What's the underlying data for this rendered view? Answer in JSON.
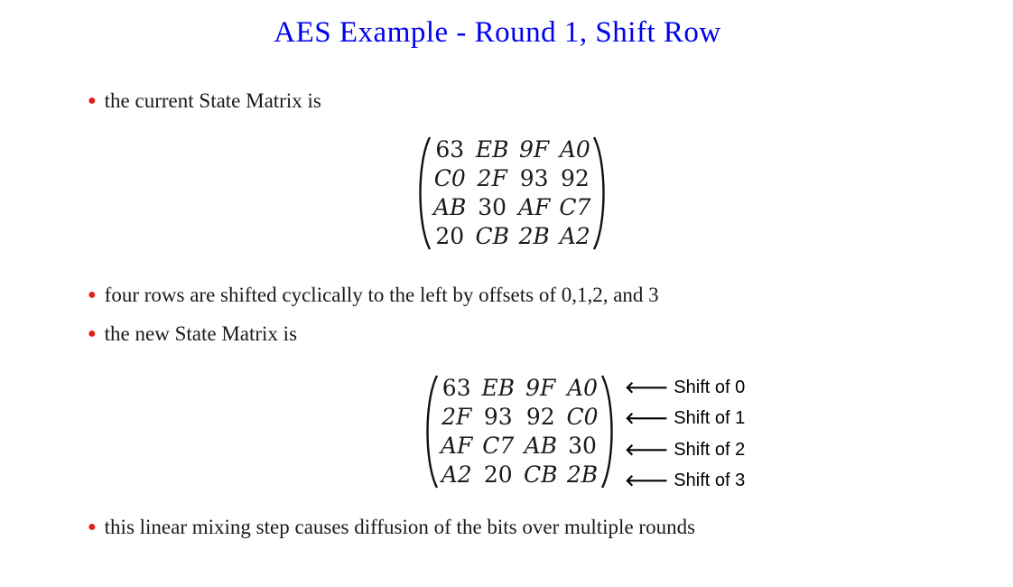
{
  "title": "AES Example - Round 1, Shift Row",
  "bullets": [
    "the current State Matrix is",
    "four rows are shifted cyclically to the left by offsets of 0,1,2, and 3",
    "the new State Matrix is",
    "this linear mixing step causes diffusion of the bits over multiple rounds"
  ],
  "current_matrix": [
    [
      "63",
      "EB",
      "9F",
      "A0"
    ],
    [
      "C0",
      "2F",
      "93",
      "92"
    ],
    [
      "AB",
      "30",
      "AF",
      "C7"
    ],
    [
      "20",
      "CB",
      "2B",
      "A2"
    ]
  ],
  "new_matrix": [
    [
      "63",
      "EB",
      "9F",
      "A0"
    ],
    [
      "2F",
      "93",
      "92",
      "C0"
    ],
    [
      "AF",
      "C7",
      "AB",
      "30"
    ],
    [
      "A2",
      "20",
      "CB",
      "2B"
    ]
  ],
  "shift_labels": [
    "Shift of 0",
    "Shift of 1",
    "Shift of 2",
    "Shift of 3"
  ],
  "icons": {
    "bullet": "bullet-dot-icon",
    "arrow": "left-arrow-icon"
  },
  "colors": {
    "title": "#0000ee",
    "bullet": "#e0201b",
    "text": "#1a1a1a"
  }
}
